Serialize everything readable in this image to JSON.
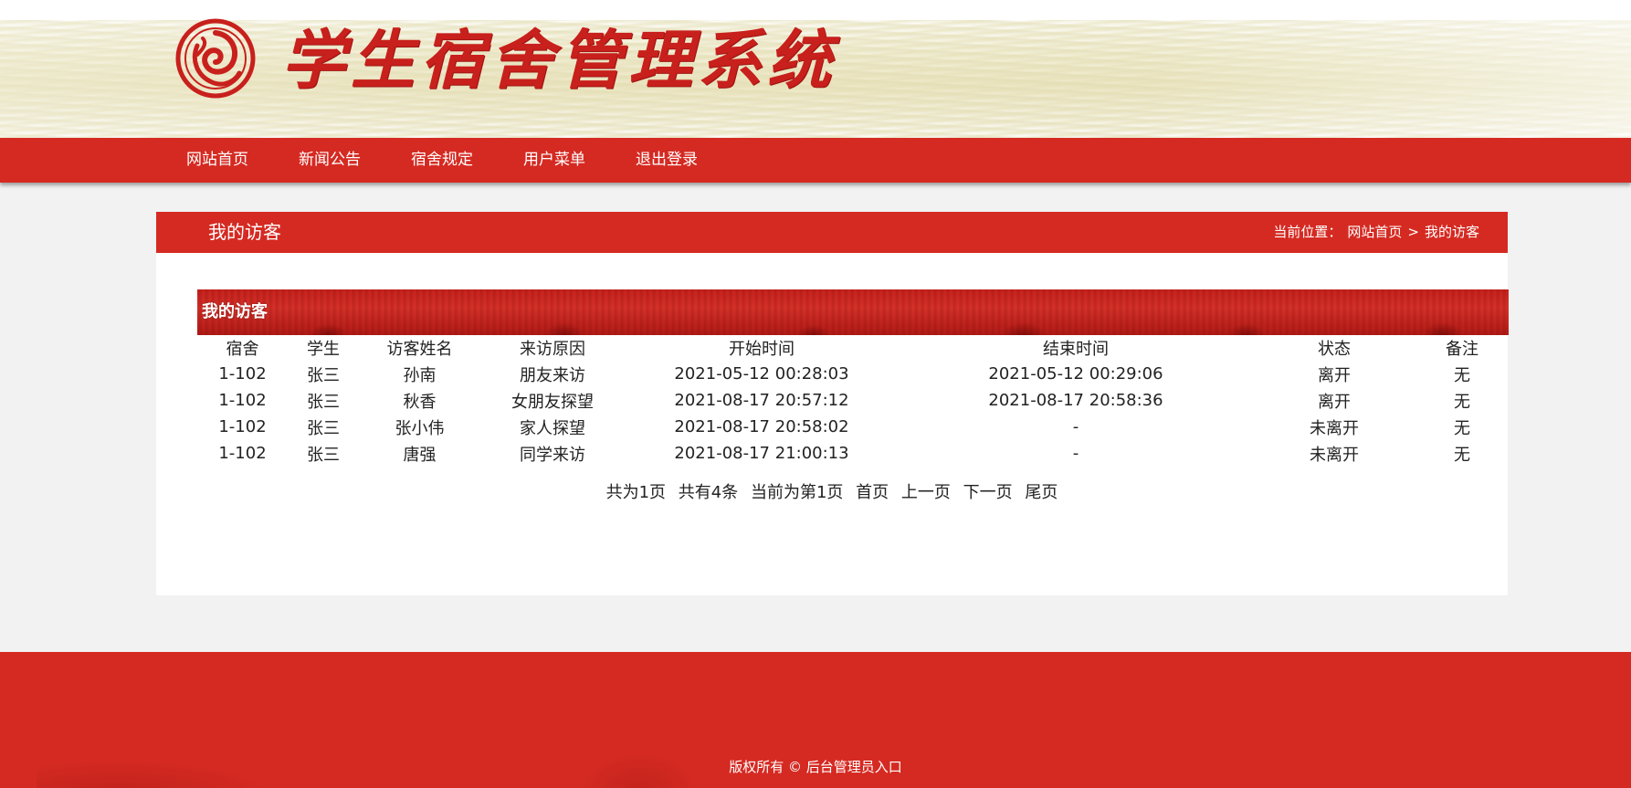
{
  "header": {
    "site_title": "学生宿舍管理系统",
    "logo_icon": "circular-seal-logo-icon"
  },
  "nav": {
    "items": [
      {
        "label": "网站首页"
      },
      {
        "label": "新闻公告"
      },
      {
        "label": "宿舍规定"
      },
      {
        "label": "用户菜单"
      },
      {
        "label": "退出登录"
      }
    ]
  },
  "panel": {
    "title": "我的访客",
    "breadcrumb": {
      "prefix": "当前位置：",
      "home": "网站首页",
      "separator": ">",
      "current": "我的访客"
    }
  },
  "visitor_list": {
    "title": "我的访客",
    "columns": [
      "宿舍",
      "学生",
      "访客姓名",
      "来访原因",
      "开始时间",
      "结束时间",
      "状态",
      "备注"
    ],
    "rows": [
      [
        "1-102",
        "张三",
        "孙南",
        "朋友来访",
        "2021-05-12 00:28:03",
        "2021-05-12 00:29:06",
        "离开",
        "无"
      ],
      [
        "1-102",
        "张三",
        "秋香",
        "女朋友探望",
        "2021-08-17 20:57:12",
        "2021-08-17 20:58:36",
        "离开",
        "无"
      ],
      [
        "1-102",
        "张三",
        "张小伟",
        "家人探望",
        "2021-08-17 20:58:02",
        "-",
        "未离开",
        "无"
      ],
      [
        "1-102",
        "张三",
        "唐强",
        "同学来访",
        "2021-08-17 21:00:13",
        "-",
        "未离开",
        "无"
      ]
    ]
  },
  "pager": {
    "total_pages": "共为1页",
    "total_items": "共有4条",
    "current_page": "当前为第1页",
    "first": "首页",
    "prev": "上一页",
    "next": "下一页",
    "last": "尾页"
  },
  "footer": {
    "copyright": "版权所有 ©",
    "admin_link": "后台管理员入口"
  },
  "colors": {
    "brand_red": "#d52a22",
    "title_red": "#c8201c",
    "page_bg": "#f2f2f2"
  }
}
